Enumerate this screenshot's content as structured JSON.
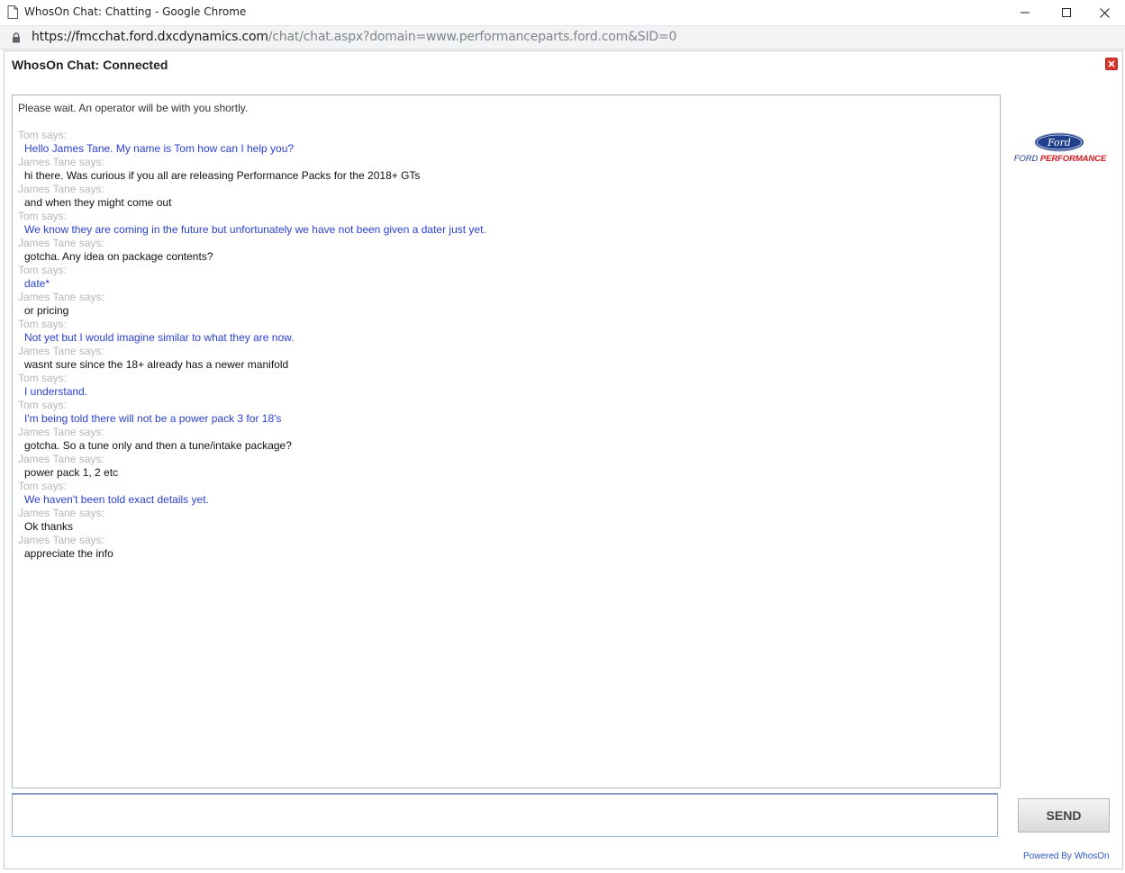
{
  "window": {
    "title": "WhosOn Chat: Chatting - Google Chrome"
  },
  "address": {
    "host": "https://fmcchat.ford.dxcdynamics.com",
    "path": "/chat/chat.aspx?domain=www.performanceparts.ford.com&SID=0"
  },
  "chat": {
    "header": "WhosOn Chat: Connected",
    "notice": "Please wait. An operator will be with you shortly.",
    "messages": [
      {
        "speaker": "Tom says:",
        "text": "Hello James Tane. My name is Tom how can I help you?"
      },
      {
        "speaker": "James Tane says:",
        "text": "hi there. Was curious if you all are releasing Performance Packs for the 2018+ GTs"
      },
      {
        "speaker": "James Tane says:",
        "text": "and when they might come out"
      },
      {
        "speaker": "Tom says:",
        "text": "We know they are coming in the future but unfortunately we have not been given a dater just yet."
      },
      {
        "speaker": "James Tane says:",
        "text": "gotcha. Any idea on package contents?"
      },
      {
        "speaker": "Tom says:",
        "text": "date*"
      },
      {
        "speaker": "James Tane says:",
        "text": "or pricing"
      },
      {
        "speaker": "Tom says:",
        "text": "Not yet but I would imagine similar to what they are now."
      },
      {
        "speaker": "James Tane says:",
        "text": "wasnt sure since the 18+ already has a newer manifold"
      },
      {
        "speaker": "Tom says:",
        "text": "I understand."
      },
      {
        "speaker": "Tom says:",
        "text": "I'm being told there will not be a power pack 3 for 18's"
      },
      {
        "speaker": "James Tane says:",
        "text": "gotcha. So a tune only and then a tune/intake package?"
      },
      {
        "speaker": "James Tane says:",
        "text": "power pack 1, 2 etc"
      },
      {
        "speaker": "Tom says:",
        "text": "We haven't been told exact details yet."
      },
      {
        "speaker": "James Tane says:",
        "text": "Ok thanks"
      },
      {
        "speaker": "James Tane says:",
        "text": "appreciate the info"
      }
    ],
    "input_value": "",
    "send_label": "SEND",
    "powered_by": "Powered By WhosOn"
  },
  "branding": {
    "oval_text": "Ford",
    "line1": "FORD ",
    "line2": "PERFORMANCE"
  },
  "colors": {
    "operator_text": "#2a40d4",
    "visitor_text": "#111111",
    "speaker_label": "#b6b6b6",
    "ford_blue": "#1f3f8c",
    "ford_red": "#d4171d"
  },
  "icons": [
    "page-icon",
    "minimize-icon",
    "maximize-icon",
    "close-icon",
    "lock-icon",
    "chat-close-icon",
    "ford-oval-logo"
  ]
}
